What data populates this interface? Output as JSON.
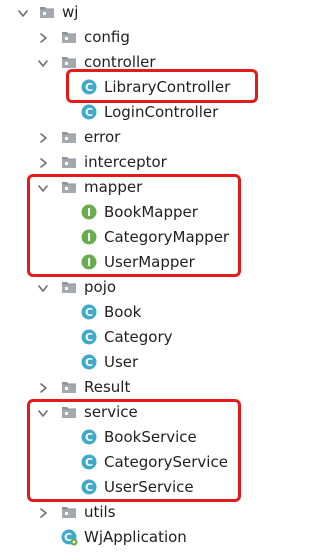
{
  "tree": {
    "root": {
      "label": "wj"
    },
    "items": [
      {
        "label": "config"
      },
      {
        "label": "controller"
      },
      {
        "label": "LibraryController"
      },
      {
        "label": "LoginController"
      },
      {
        "label": "error"
      },
      {
        "label": "interceptor"
      },
      {
        "label": "mapper"
      },
      {
        "label": "BookMapper"
      },
      {
        "label": "CategoryMapper"
      },
      {
        "label": "UserMapper"
      },
      {
        "label": "pojo"
      },
      {
        "label": "Book"
      },
      {
        "label": "Category"
      },
      {
        "label": "User"
      },
      {
        "label": "Result"
      },
      {
        "label": "service"
      },
      {
        "label": "BookService"
      },
      {
        "label": "CategoryService"
      },
      {
        "label": "UserService"
      },
      {
        "label": "utils"
      },
      {
        "label": "WjApplication"
      }
    ]
  },
  "icons": {
    "folder": "package-folder-icon",
    "class": "class-icon",
    "interface": "interface-icon",
    "app": "spring-application-icon"
  },
  "colors": {
    "highlight": "#e41b1b",
    "class_icon": "#3fa9c9",
    "interface_icon": "#67ad4e",
    "folder": "#8d9399",
    "text": "#1f1f1f"
  }
}
